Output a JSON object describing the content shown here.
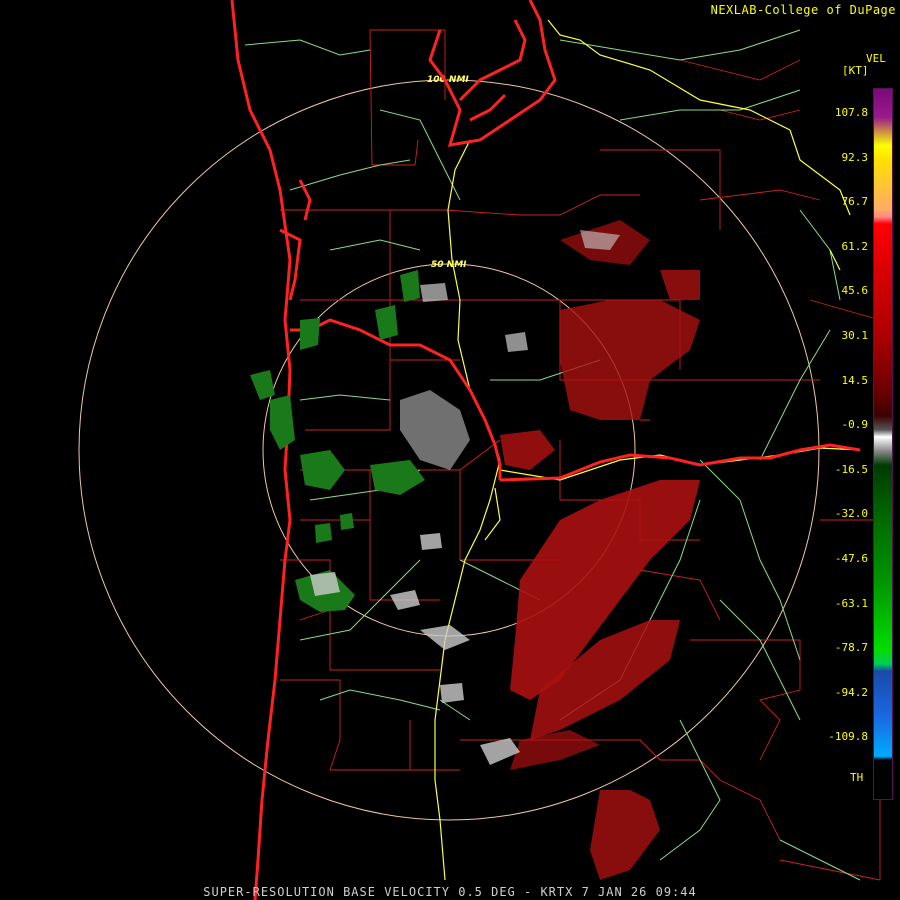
{
  "credit": "NEXLAB-College of DuPage",
  "legend": {
    "title": "VEL",
    "unit": "[KT]",
    "ticks": [
      "107.8",
      "92.3",
      "76.7",
      "61.2",
      "45.6",
      "30.1",
      "14.5",
      "-0.9",
      "-16.5",
      "-32.0",
      "-47.6",
      "-63.1",
      "-78.7",
      "-94.2",
      "-109.8",
      "TH"
    ],
    "tick_values_kt": [
      107.8,
      92.3,
      76.7,
      61.2,
      45.6,
      30.1,
      14.5,
      -0.9,
      -16.5,
      -32.0,
      -47.6,
      -63.1,
      -78.7,
      -94.2,
      -109.8
    ]
  },
  "range_rings": {
    "inner": "50 NMI",
    "outer": "100 NMI"
  },
  "footer": "SUPER-RESOLUTION BASE VELOCITY 0.5 DEG - KRTX 7 JAN 26 09:44",
  "colors": {
    "state_border": "#ff2020",
    "county_border": "#cc2222",
    "interstate": "#ffff40",
    "highway": "#88dd88",
    "range_ring": "#f0c8a0",
    "inbound_green": "#1a7a1a",
    "outbound_red": "#aa1010",
    "near_zero": "#cccccc"
  }
}
